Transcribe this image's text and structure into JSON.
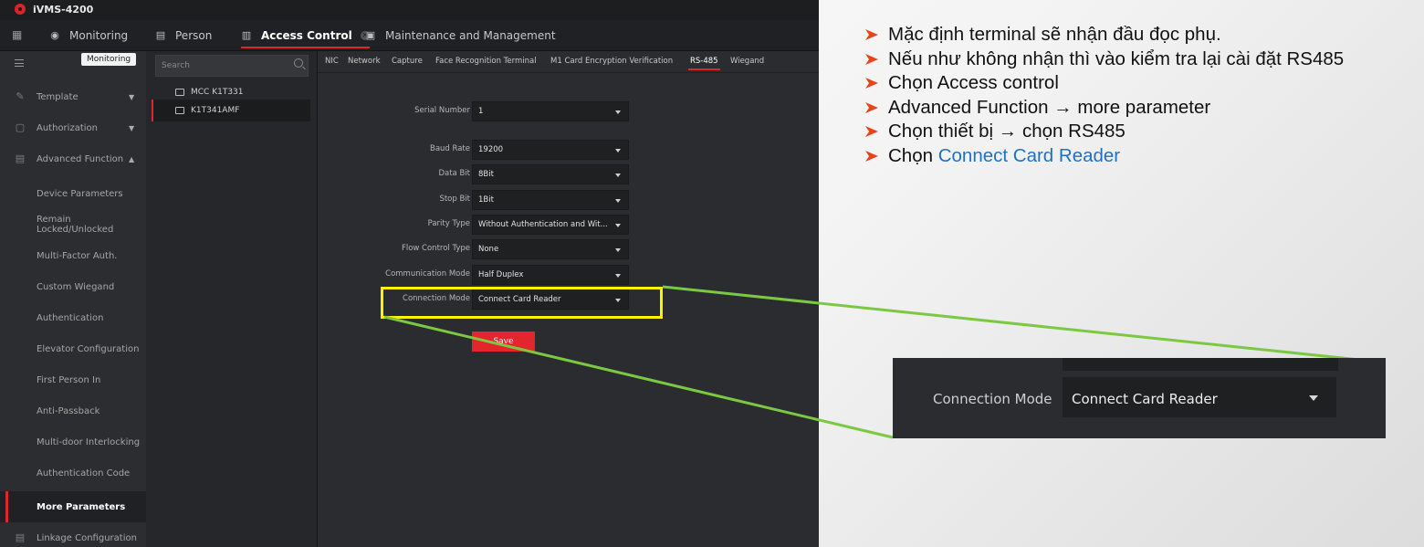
{
  "app": {
    "title": "iVMS-4200",
    "tabs": [
      {
        "label": "Monitoring",
        "icon": "camera-icon",
        "active": false
      },
      {
        "label": "Person",
        "icon": "person-card-icon",
        "active": false
      },
      {
        "label": "Access Control",
        "icon": "door-icon",
        "active": true
      },
      {
        "label": "Maintenance and Management",
        "icon": "clipboard-icon",
        "active": false
      }
    ],
    "tooltip": "Monitoring"
  },
  "sidebar": {
    "items": [
      {
        "label": "Template",
        "type": "section"
      },
      {
        "label": "Authorization",
        "type": "section"
      },
      {
        "label": "Advanced Function",
        "type": "section"
      },
      {
        "label": "Device Parameters",
        "type": "sub"
      },
      {
        "label": "Remain Locked/Unlocked",
        "type": "sub"
      },
      {
        "label": "Multi-Factor Auth.",
        "type": "sub"
      },
      {
        "label": "Custom Wiegand",
        "type": "sub"
      },
      {
        "label": "Authentication",
        "type": "sub"
      },
      {
        "label": "Elevator Configuration",
        "type": "sub"
      },
      {
        "label": "First Person In",
        "type": "sub"
      },
      {
        "label": "Anti-Passback",
        "type": "sub"
      },
      {
        "label": "Multi-door Interlocking",
        "type": "sub"
      },
      {
        "label": "Authentication Code",
        "type": "sub"
      },
      {
        "label": "More Parameters",
        "type": "sub",
        "selected": true
      },
      {
        "label": "Linkage Configuration",
        "type": "section"
      }
    ]
  },
  "devices": {
    "search_placeholder": "Search",
    "items": [
      {
        "label": "MCC K1T331",
        "selected": false
      },
      {
        "label": "K1T341AMF",
        "selected": true
      }
    ]
  },
  "subtabs": [
    "NIC",
    "Network",
    "Capture",
    "Face Recognition Terminal",
    "M1 Card Encryption Verification",
    "RS-485",
    "Wiegand"
  ],
  "active_subtab": "RS-485",
  "form": {
    "fields": [
      {
        "label": "Serial Number",
        "value": "1"
      },
      {
        "label": "Baud Rate",
        "value": "19200"
      },
      {
        "label": "Data Bit",
        "value": "8Bit"
      },
      {
        "label": "Stop Bit",
        "value": "1Bit"
      },
      {
        "label": "Parity Type",
        "value": "Without Authentication and Wit..."
      },
      {
        "label": "Flow Control Type",
        "value": "None"
      },
      {
        "label": "Communication Mode",
        "value": "Half Duplex"
      },
      {
        "label": "Connection Mode",
        "value": "Connect Card Reader"
      }
    ],
    "save_label": "Save"
  },
  "instructions": {
    "items": [
      {
        "text": "Mặc định terminal sẽ nhận đầu đọc phụ."
      },
      {
        "text": "Nếu như không nhận thì vào kiểm tra lại cài đặt RS485"
      },
      {
        "text": "Chọn Access control"
      },
      {
        "text": "Advanced Function → more parameter"
      },
      {
        "text": "Chọn thiết bị → chọn RS485"
      },
      {
        "prefix": "Chọn ",
        "link": "Connect Card Reader"
      }
    ]
  },
  "zoom": {
    "label": "Connection Mode",
    "value": "Connect Card Reader"
  },
  "colors": {
    "accent": "#e0252b",
    "highlight_box": "#fcf301",
    "callout_line": "#7bc943",
    "bullet_arrow": "#e8441a",
    "link": "#1f72c0"
  }
}
